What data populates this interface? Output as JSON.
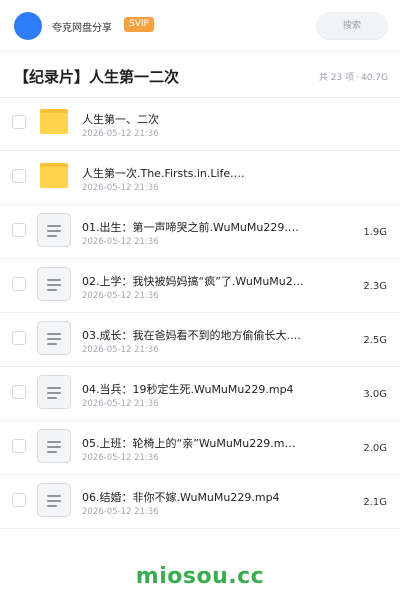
{
  "header": {
    "share_name": "夸克网盘分享",
    "badge": "SVIP",
    "search_placeholder": "搜索",
    "avatar_color": "#2f7cf6",
    "badge_color": "#f6a243"
  },
  "title": {
    "text": "【纪录片】人生第一二次",
    "count": "共 23 项",
    "separator": "·",
    "total_size": "40.7G"
  },
  "items": [
    {
      "type": "folder",
      "icon": "folder-icon",
      "name": "人生第一、二次",
      "date": "2026-05-12 21:36",
      "size": ""
    },
    {
      "type": "folder",
      "icon": "folder-icon",
      "name": "人生第一次.The.Firsts.in.Life.…",
      "date": "2026-05-12 21:36",
      "size": ""
    },
    {
      "type": "file",
      "icon": "document-icon",
      "name": "01.出生：第一声啼哭之前.WuMuMu229.m…",
      "date": "2026-05-12 21:36",
      "size": "1.9G"
    },
    {
      "type": "file",
      "icon": "document-icon",
      "name": "02.上学：我快被妈妈搞“疯”了.WuMuMu22…",
      "date": "2026-05-12 21:36",
      "size": "2.3G"
    },
    {
      "type": "file",
      "icon": "document-icon",
      "name": "03.成长：我在爸妈看不到的地方偷偷长大.WuMu…",
      "date": "2026-05-12 21:36",
      "size": "2.5G"
    },
    {
      "type": "file",
      "icon": "document-icon",
      "name": "04.当兵：19秒定生死.WuMuMu229.mp4",
      "date": "2026-05-12 21:36",
      "size": "3.0G"
    },
    {
      "type": "file",
      "icon": "document-icon",
      "name": "05.上班：轮椅上的“亲”WuMuMu229.m…",
      "date": "2026-05-12 21:36",
      "size": "2.0G"
    },
    {
      "type": "file",
      "icon": "document-icon",
      "name": "06.结婚：非你不嫁.WuMuMu229.mp4",
      "date": "2026-05-12 21:36",
      "size": "2.1G"
    }
  ],
  "watermark": {
    "text": "miosou.cc",
    "color": "#3aae4f"
  }
}
